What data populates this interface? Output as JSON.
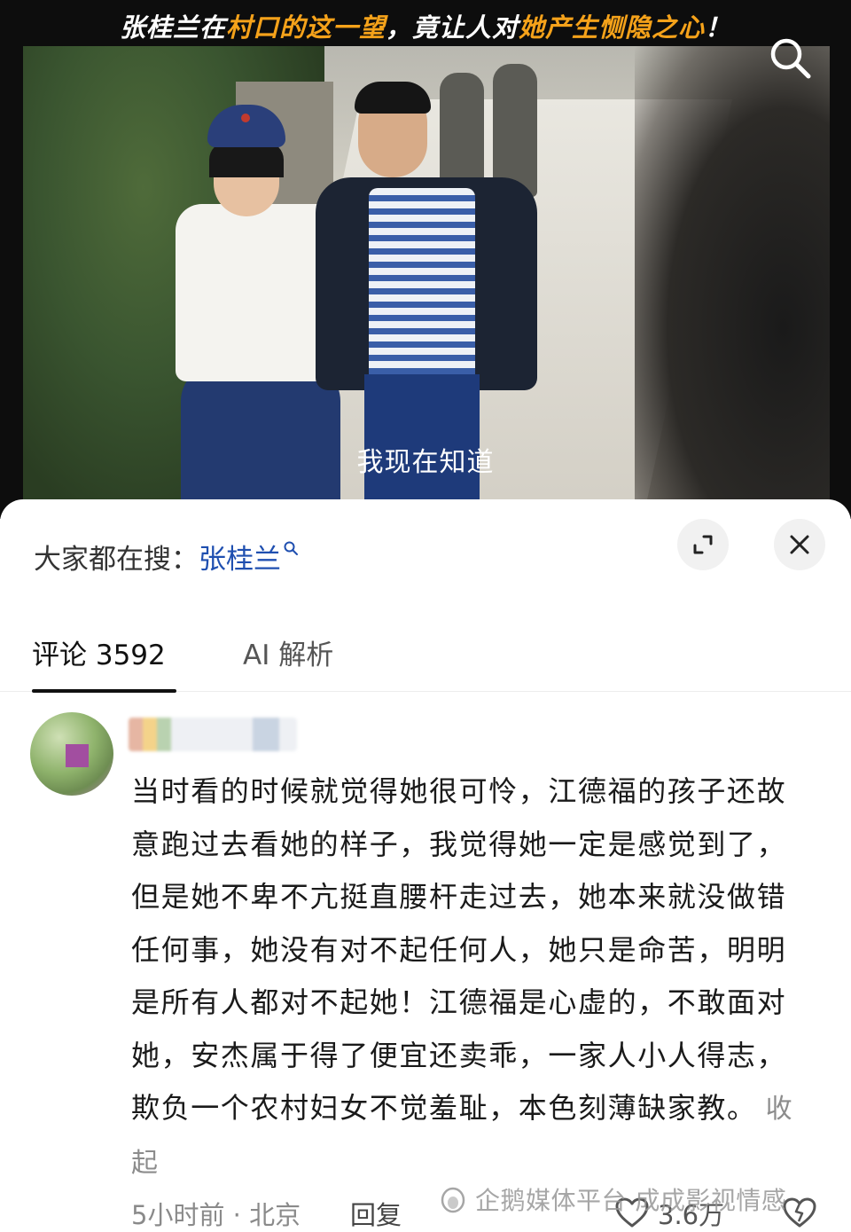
{
  "video": {
    "title_part1": "张桂兰在",
    "title_highlight1": "村口的这一望",
    "title_part2": "，竟让人对",
    "title_highlight2": "她产生恻隐之心",
    "title_part3": "！",
    "subtitle": "我现在知道",
    "search_icon": "search-icon"
  },
  "hot_search": {
    "prefix": "大家都在搜：",
    "term": "张桂兰",
    "term_icon": "search-mini-icon"
  },
  "actions": {
    "expand_icon": "expand-icon",
    "close_icon": "close-icon"
  },
  "tabs": [
    {
      "label": "评论 3592",
      "active": true
    },
    {
      "label": "AI 解析",
      "active": false
    }
  ],
  "comment": {
    "text": "当时看的时候就觉得她很可怜，江德福的孩子还故意跑过去看她的样子，我觉得她一定是感觉到了，但是她不卑不亢挺直腰杆走过去，她本来就没做错任何事，她没有对不起任何人，她只是命苦，明明是所有人都对不起她！江德福是心虚的，不敢面对她，安杰属于得了便宜还卖乖，一家人小人得志，欺负一个农村妇女不觉羞耻，本色刻薄缺家教。",
    "collapse_label": "收起",
    "time_location": "5小时前 · 北京",
    "reply_label": "回复",
    "like_count": "3.6万"
  },
  "watermark": "企鹅媒体平台 成成影视情感",
  "colors": {
    "title_highlight": "#f5a21a",
    "link_blue": "#1f4fb0"
  }
}
